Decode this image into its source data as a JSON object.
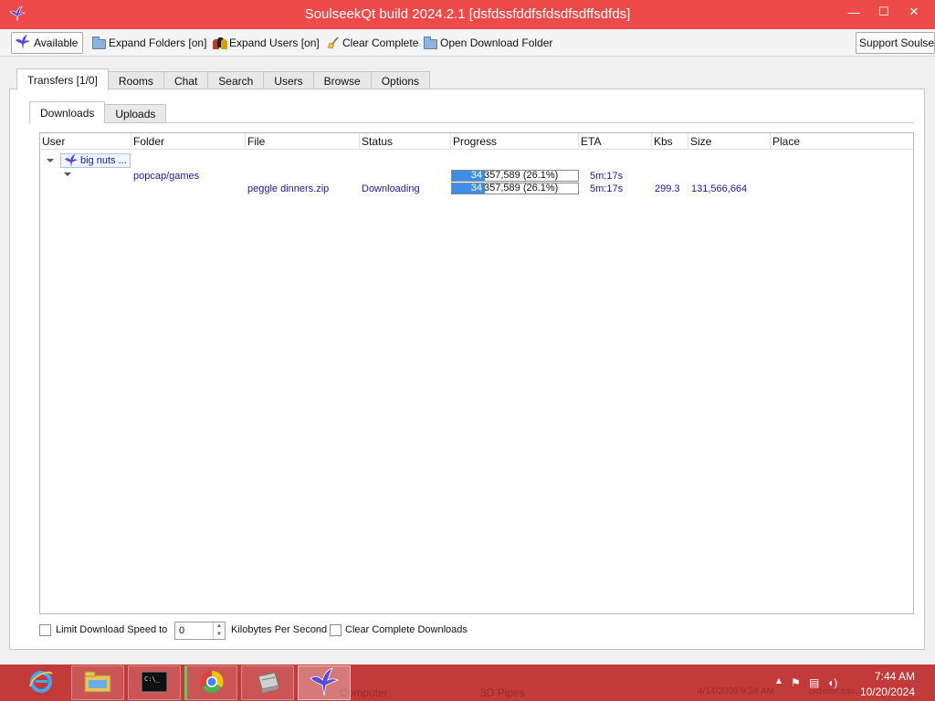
{
  "window": {
    "title": "SoulseekQt build 2024.2.1 [dsfdssfddfsfdsdfsdffsdfds]",
    "minimize": "—",
    "maximize": "☐",
    "close": "✕"
  },
  "toolbar": {
    "status_label": "Available",
    "expand_folders_label": "Expand Folders [on]",
    "expand_users_label": "Expand Users [on]",
    "clear_complete_label": "Clear Complete",
    "open_download_folder_label": "Open Download Folder",
    "support_label": "Support Soulseek"
  },
  "tabs": {
    "main": [
      "Transfers [1/0]",
      "Rooms",
      "Chat",
      "Search",
      "Users",
      "Browse",
      "Options"
    ],
    "sub": [
      "Downloads",
      "Uploads"
    ]
  },
  "table": {
    "columns": [
      "User",
      "Folder",
      "File",
      "Status",
      "Progress",
      "ETA",
      "Kbs",
      "Size",
      "Place"
    ],
    "user": "big nuts ...",
    "folder_row": {
      "folder": "popcap/games",
      "progress_pct": "34",
      "progress_text": "357,589 (26.1%)",
      "progress_fraction": 0.26,
      "eta": "5m:17s"
    },
    "file_row": {
      "file": "peggle dinners.zip",
      "status": "Downloading",
      "progress_pct": "34",
      "progress_text": "357,589 (26.1%)",
      "progress_fraction": 0.26,
      "eta": "5m:17s",
      "kbs": "299.3",
      "size": "131,566,664"
    }
  },
  "bottom": {
    "limit_label": "Limit Download Speed to",
    "speed_value": "0",
    "unit_label": "Kilobytes Per Second",
    "clear_label": "Clear Complete Downloads"
  },
  "taskbar": {
    "time": "7:44 AM",
    "date": "10/20/2024",
    "ghost_computer": "Computer",
    "ghost_pipes": "3D Pipes",
    "ghost_date": "4/14/2008 9:38 AM",
    "ghost_screen": "Screen sav..."
  },
  "colors": {
    "title_bar": "#ee4a4a",
    "taskbar": "#c33a3a",
    "progress_fill": "#3c8ee6",
    "link_text": "#1a1aa0"
  },
  "icons": {
    "app": "soulseek-bird-icon",
    "folder": "folder-icon",
    "users": "users-icon",
    "clear": "broom-icon",
    "taskbar": [
      "internet-explorer-icon",
      "file-explorer-icon",
      "command-prompt-icon",
      "chrome-icon",
      "drive-icon",
      "soulseek-bird-icon"
    ]
  }
}
